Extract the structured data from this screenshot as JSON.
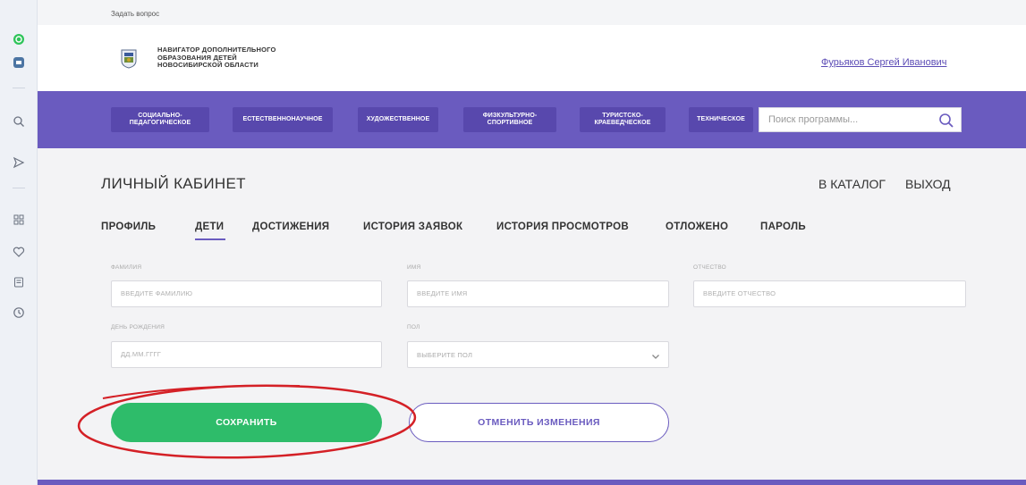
{
  "top": {
    "ask_question": "Задать вопрос"
  },
  "header": {
    "logo_lines": [
      "НАВИГАТОР ДОПОЛНИТЕЛЬНОГО",
      "ОБРАЗОВАНИЯ ДЕТЕЙ",
      "НОВОСИБИРСКОЙ ОБЛАСТИ"
    ],
    "user_name": "Фурьяков Сергей Иванович"
  },
  "nav": {
    "items": [
      {
        "label": "СОЦИАЛЬНО-\nПЕДАГОГИЧЕСКОЕ"
      },
      {
        "label": "ЕСТЕСТВЕННОНАУЧНОЕ"
      },
      {
        "label": "ХУДОЖЕСТВЕННОЕ"
      },
      {
        "label": "ФИЗКУЛЬТУРНО-\nСПОРТИВНОЕ"
      },
      {
        "label": "ТУРИСТСКО-\nКРАЕВЕДЧЕСКОЕ"
      },
      {
        "label": "ТЕХНИЧЕСКОЕ"
      }
    ],
    "search_placeholder": "Поиск программы..."
  },
  "main": {
    "title": "ЛИЧНЫЙ КАБИНЕТ",
    "catalog_link": "В КАТАЛОГ",
    "logout_link": "ВЫХОД",
    "tabs": [
      {
        "label": "ПРОФИЛЬ"
      },
      {
        "label": "ДЕТИ"
      },
      {
        "label": "ДОСТИЖЕНИЯ"
      },
      {
        "label": "ИСТОРИЯ ЗАЯВОК"
      },
      {
        "label": "ИСТОРИЯ ПРОСМОТРОВ"
      },
      {
        "label": "ОТЛОЖЕНО"
      },
      {
        "label": "ПАРОЛЬ"
      }
    ],
    "active_tab": "ДЕТИ",
    "form": {
      "lastname_label": "ФАМИЛИЯ",
      "lastname_placeholder": "ВВЕДИТЕ ФАМИЛИЮ",
      "firstname_label": "ИМЯ",
      "firstname_placeholder": "ВВЕДИТЕ ИМЯ",
      "patronymic_label": "ОТЧЕСТВО",
      "patronymic_placeholder": "ВВЕДИТЕ ОТЧЕСТВО",
      "birthdate_label": "ДЕНЬ РОЖДЕНИЯ",
      "birthdate_placeholder": "ДД.ММ.ГГГГ",
      "gender_label": "ПОЛ",
      "gender_value": "ВЫБЕРИТЕ ПОЛ"
    },
    "save_label": "СОХРАНИТЬ",
    "cancel_label": "ОТМЕНИТЬ ИЗМЕНЕНИЯ"
  },
  "colors": {
    "accent_purple": "#6a5bbf",
    "save_green": "#2ebc6a",
    "highlight_red": "#d42026",
    "user_link": "#5b4bb5"
  },
  "icons": {
    "leftbar": [
      "whatsapp-icon",
      "vk-icon",
      "search-icon",
      "send-icon",
      "apps-icon",
      "heart-icon",
      "notes-icon",
      "history-icon"
    ],
    "search": "magnifier-icon",
    "select": "chevron-down-icon",
    "logo": "coat-of-arms-icon"
  }
}
